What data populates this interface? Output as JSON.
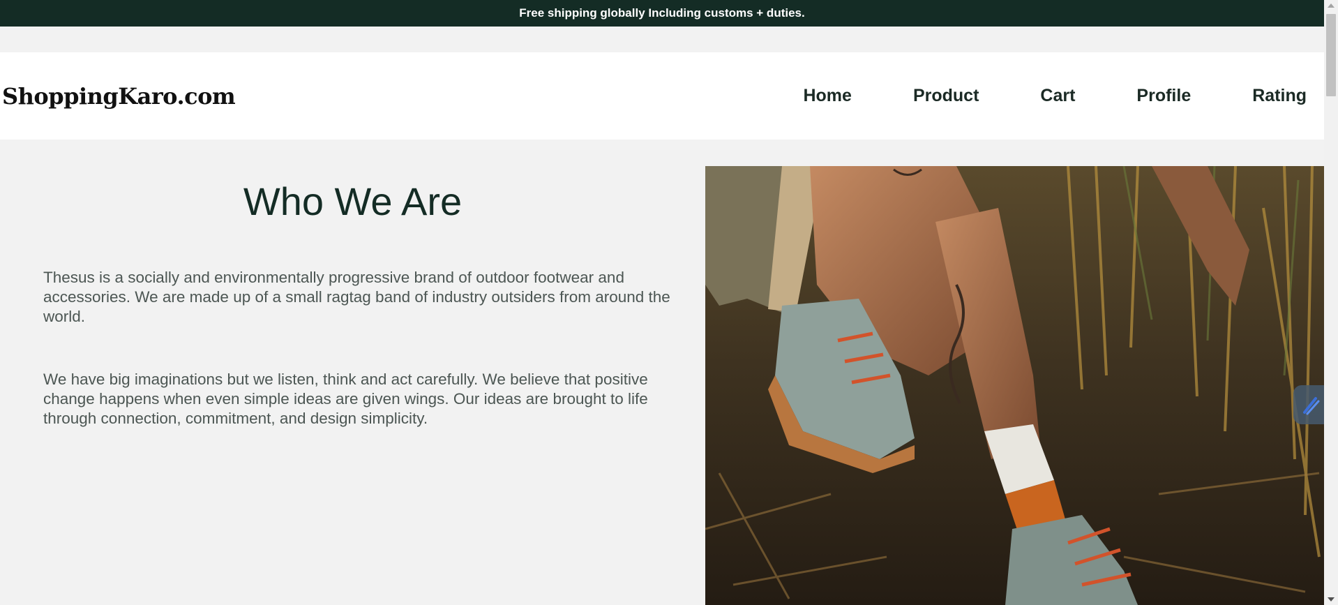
{
  "announcement": "Free shipping globally Including customs + duties.",
  "brand": {
    "logo_text": "ShoppingKaro.com"
  },
  "nav": {
    "items": [
      {
        "label": "Home"
      },
      {
        "label": "Product"
      },
      {
        "label": "Cart"
      },
      {
        "label": "Profile"
      },
      {
        "label": "Rating"
      }
    ]
  },
  "about": {
    "title": "Who We Are",
    "paragraph_1": "Thesus is a socially and environmentally progressive brand of outdoor footwear and accessories. We are made up of a small ragtag band of industry outsiders from around the world.",
    "paragraph_2": "We have big imaginations but we listen, think and act carefully. We believe that positive change happens when even simple ideas are given wings. Our ideas are brought to life through connection, commitment, and design simplicity."
  },
  "colors": {
    "topbar_bg": "#142c25",
    "page_bg": "#f2f2f2",
    "header_bg": "#ffffff",
    "title_color": "#142c25",
    "body_text": "#4c5653"
  },
  "icons": {
    "photo": "hiking-boots-photo",
    "float_tab": "edit-pen-icon"
  }
}
